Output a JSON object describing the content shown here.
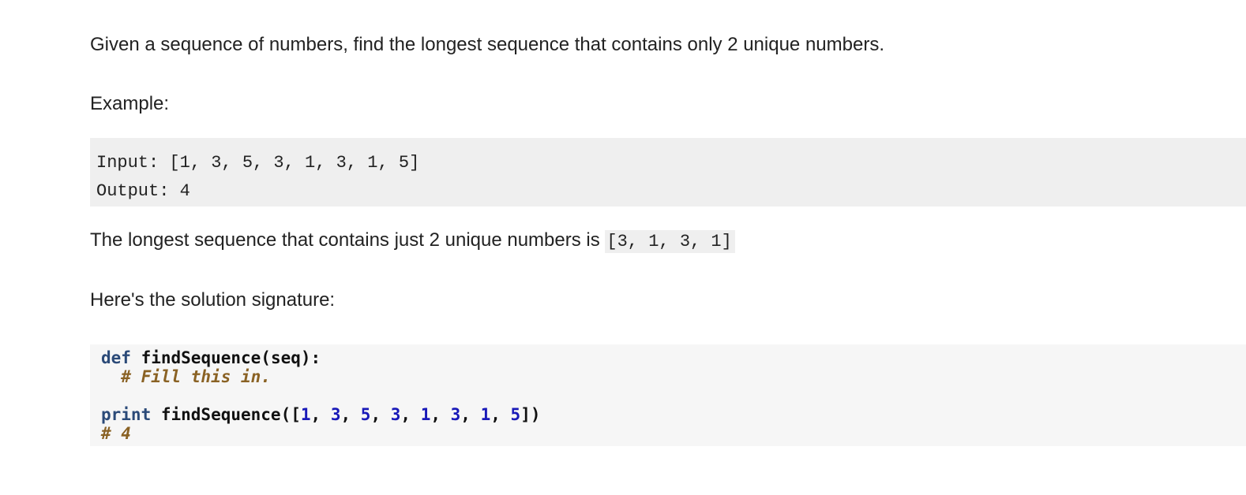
{
  "intro": "Given a sequence of numbers, find the longest sequence that contains only 2 unique numbers.",
  "example_label": "Example:",
  "example": {
    "input_line": "Input: [1, 3, 5, 3, 1, 3, 1, 5]",
    "output_line": "Output: 4"
  },
  "longest": {
    "text": "The longest sequence that contains just 2 unique numbers is ",
    "code": "[3, 1, 3, 1]"
  },
  "signature_label": "Here's the solution signature:",
  "code": {
    "def_kw": "def",
    "def_rest": " findSequence(seq):",
    "comment1": "  # Fill this in.",
    "print_kw": "print",
    "print_rest": " findSequence([",
    "args": [
      "1",
      "3",
      "5",
      "3",
      "1",
      "3",
      "1",
      "5"
    ],
    "separator": ", ",
    "closing": "])",
    "comment2": "# 4"
  },
  "colors": {
    "keyword": "#2b4a78",
    "comment": "#8a6224",
    "number": "#1919b8",
    "example_bg": "#efefef",
    "code_bg": "#f6f6f6"
  }
}
